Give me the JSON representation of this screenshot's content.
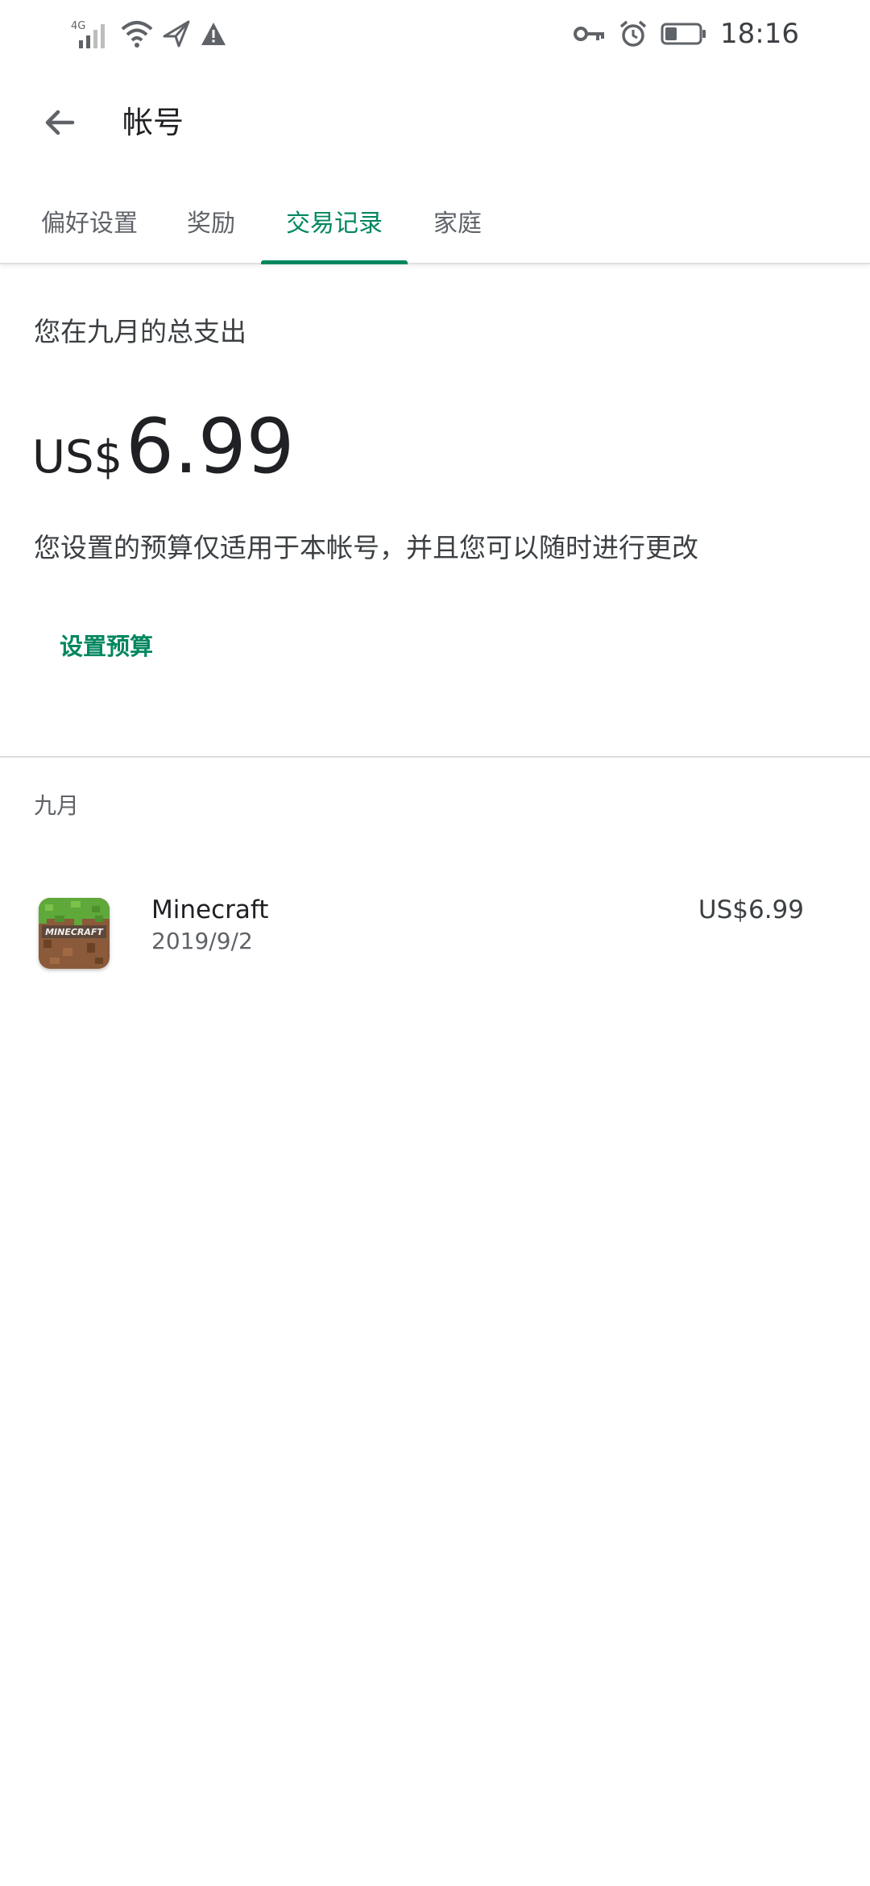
{
  "status_bar": {
    "network": "4G",
    "time": "18:16",
    "icons": [
      "signal-icon",
      "wifi-icon",
      "airplane-icon",
      "warning-icon",
      "key-icon",
      "alarm-icon",
      "battery-icon"
    ]
  },
  "app_bar": {
    "title": "帐号",
    "back_icon": "arrow-back-icon"
  },
  "tabs": [
    {
      "label": "偏好设置",
      "active": false
    },
    {
      "label": "奖励",
      "active": false
    },
    {
      "label": "交易记录",
      "active": true
    },
    {
      "label": "家庭",
      "active": false
    }
  ],
  "summary": {
    "label": "您在九月的总支出",
    "currency": "US$",
    "amount": "6.99",
    "budget_note": "您设置的预算仅适用于本帐号，并且您可以随时进行更改",
    "set_budget_label": "设置预算"
  },
  "history": {
    "month": "九月",
    "transactions": [
      {
        "name": "Minecraft",
        "date": "2019/9/2",
        "price": "US$6.99",
        "icon": "minecraft-app-icon",
        "icon_text": "MINECRAFT"
      }
    ]
  },
  "colors": {
    "accent": "#01875f",
    "text_primary": "#202124",
    "text_secondary": "#5f6368",
    "divider": "#dadce0"
  }
}
